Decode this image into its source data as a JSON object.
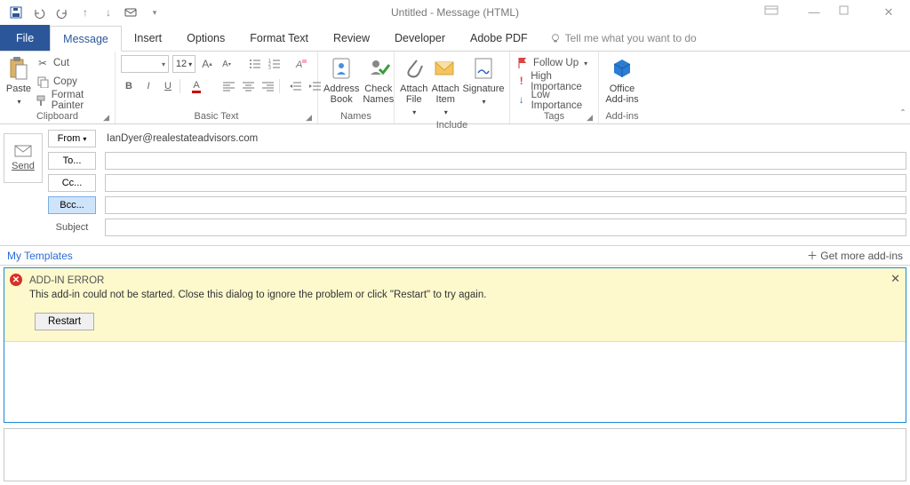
{
  "window": {
    "title": "Untitled - Message (HTML)"
  },
  "tabs": {
    "file": "File",
    "message": "Message",
    "insert": "Insert",
    "options": "Options",
    "format": "Format Text",
    "review": "Review",
    "developer": "Developer",
    "adobe": "Adobe PDF",
    "tellme": "Tell me what you want to do"
  },
  "ribbon": {
    "paste": "Paste",
    "cut": "Cut",
    "copy": "Copy",
    "format_painter": "Format Painter",
    "clipboard_group": "Clipboard",
    "font_size": "12",
    "basic_text_group": "Basic Text",
    "address_book": "Address\nBook",
    "check_names": "Check\nNames",
    "names_group": "Names",
    "attach_file": "Attach\nFile",
    "attach_item": "Attach\nItem",
    "signature": "Signature",
    "include_group": "Include",
    "follow_up": "Follow Up",
    "high_importance": "High Importance",
    "low_importance": "Low Importance",
    "tags_group": "Tags",
    "office_addins": "Office\nAdd-ins",
    "addins_group": "Add-ins"
  },
  "compose": {
    "send": "Send",
    "from_btn": "From",
    "from_value": "IanDyer@realestateadvisors.com",
    "to": "To...",
    "cc": "Cc...",
    "bcc": "Bcc...",
    "subject": "Subject"
  },
  "templates": {
    "title": "My Templates",
    "get_more": "Get more add-ins"
  },
  "error": {
    "title": "ADD-IN ERROR",
    "message": "This add-in could not be started. Close this dialog to ignore the problem or click \"Restart\" to try again.",
    "restart": "Restart"
  }
}
